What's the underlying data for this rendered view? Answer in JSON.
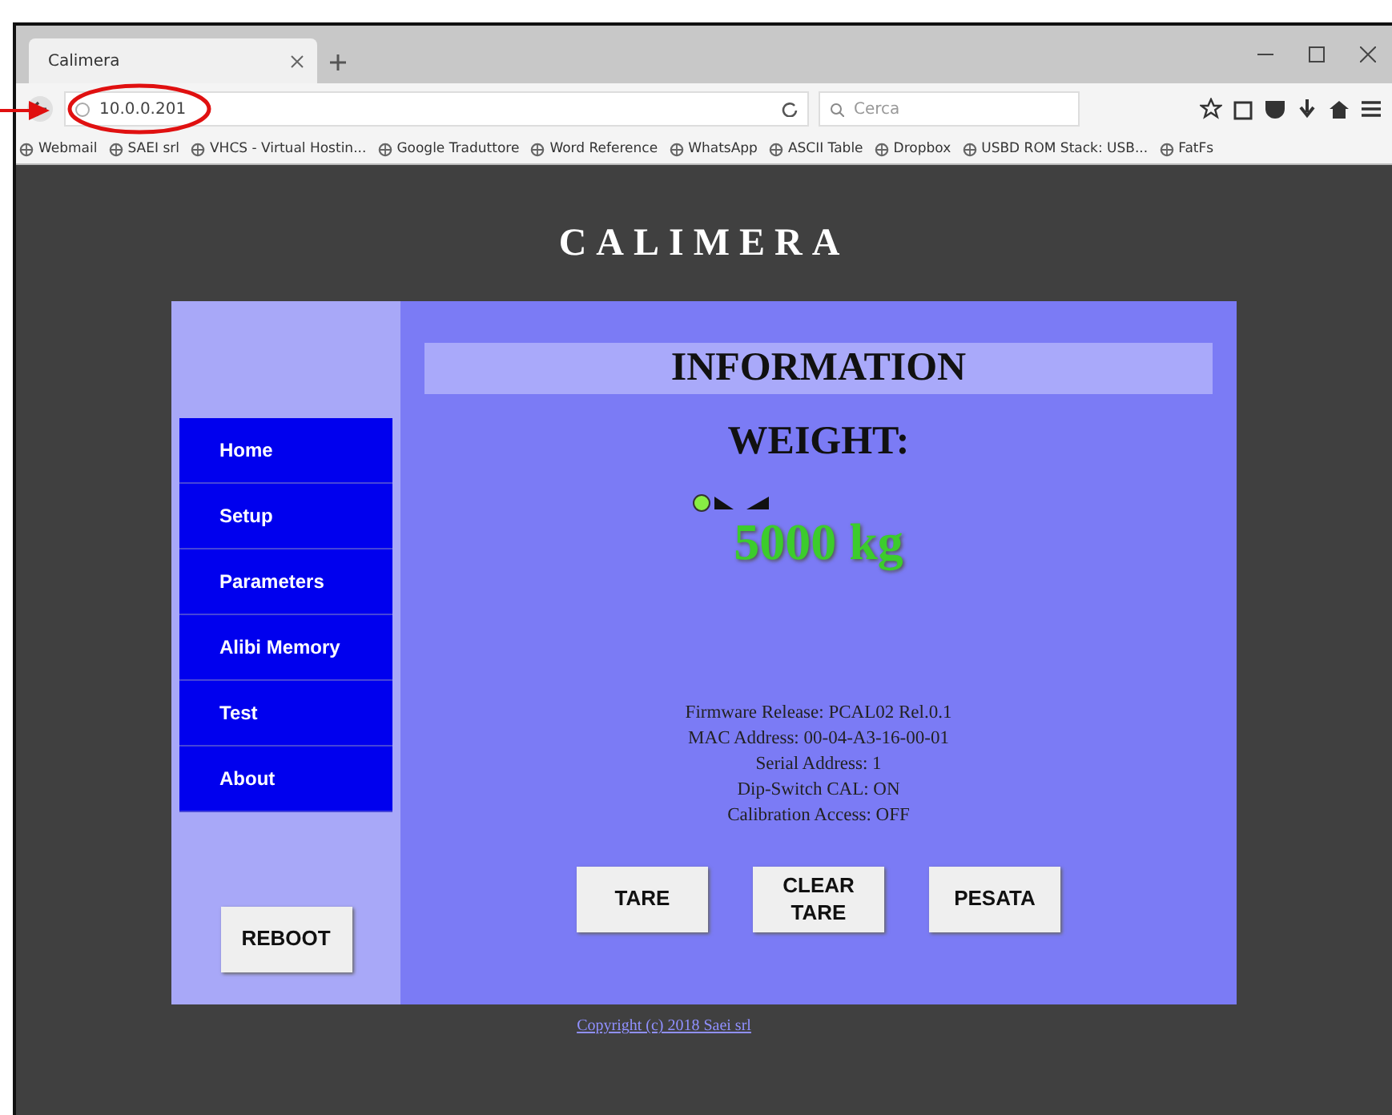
{
  "browser": {
    "tab_title": "Calimera",
    "address": "10.0.0.201",
    "search_placeholder": "Cerca",
    "bookmarks": [
      "Webmail",
      "SAEI srl",
      "VHCS - Virtual Hostin...",
      "Google Traduttore",
      "Word Reference",
      "WhatsApp",
      "ASCII Table",
      "Dropbox",
      "USBD ROM Stack: USB...",
      "FatFs"
    ]
  },
  "page": {
    "brand": "CALIMERA",
    "heading": "INFORMATION",
    "weight_label": "WEIGHT:",
    "weight_value": "5000 kg",
    "nav": [
      {
        "label": "Home"
      },
      {
        "label": "Setup"
      },
      {
        "label": "Parameters"
      },
      {
        "label": "Alibi Memory"
      },
      {
        "label": "Test"
      },
      {
        "label": "About"
      }
    ],
    "reboot": "REBOOT",
    "info_lines": [
      "Firmware Release: PCAL02 Rel.0.1",
      "MAC Address: 00-04-A3-16-00-01",
      "Serial Address: 1",
      "Dip-Switch CAL: ON",
      "Calibration Access: OFF"
    ],
    "actions": [
      [
        "TARE"
      ],
      [
        "CLEAR",
        "TARE"
      ],
      [
        "PESATA"
      ]
    ],
    "copyright": "Copyright (c) 2018 Saei srl"
  }
}
